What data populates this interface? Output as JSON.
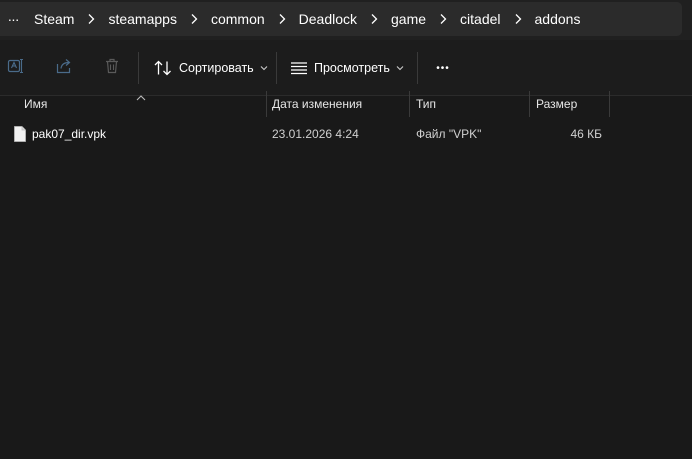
{
  "breadcrumb": {
    "overflow_label": "···",
    "items": [
      {
        "label": "Steam"
      },
      {
        "label": "steamapps"
      },
      {
        "label": "common"
      },
      {
        "label": "Deadlock"
      },
      {
        "label": "game"
      },
      {
        "label": "citadel"
      },
      {
        "label": "addons"
      }
    ]
  },
  "toolbar": {
    "rename_icon": "rename-icon",
    "share_icon": "share-icon",
    "delete_icon": "trash-icon",
    "sort_label": "Сортировать",
    "view_label": "Просмотреть",
    "more_label": "•••"
  },
  "columns": {
    "name": "Имя",
    "date": "Дата изменения",
    "type": "Тип",
    "size": "Размер"
  },
  "files": [
    {
      "name": "pak07_dir.vpk",
      "date": "23.01.2026 4:24",
      "type": "Файл \"VPK\"",
      "size": "46 КБ",
      "icon": "file-icon"
    }
  ],
  "colors": {
    "background": "#191919",
    "address_bar": "#2b2b2b",
    "divider": "#3a3a3a",
    "text": "#ffffff",
    "disabled_icon": "#5a5a5a"
  }
}
